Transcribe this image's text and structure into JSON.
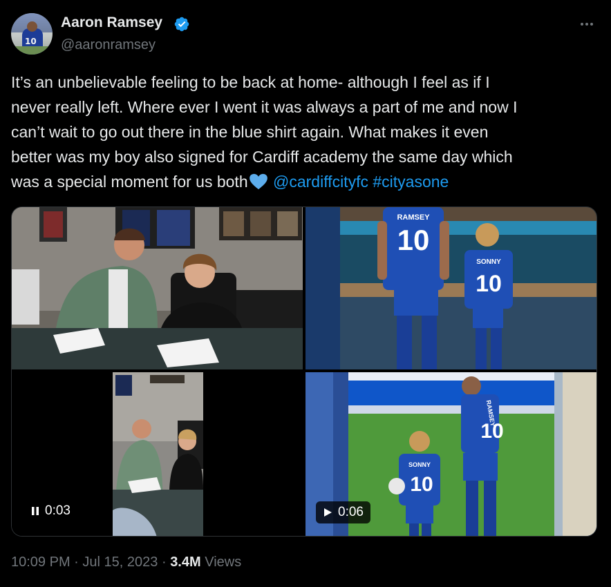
{
  "author": {
    "name": "Aaron Ramsey",
    "handle": "@aaronramsey",
    "avatar_jersey_number": "10",
    "verified": true
  },
  "tweet": {
    "line1": "It’s an unbelievable feeling to be back at home- although I feel as if I",
    "line2": "never really left. Where ever I went it was always a part of me and now I",
    "line3": "can’t wait to go out there in the blue shirt again.  What makes it even",
    "line4": "better was my boy also signed for Cardiff academy the same day which",
    "line5": "was a special moment for us both",
    "mention": "@cardiffcityfc",
    "hashtag": "#cityasone",
    "emoji": "blue-heart"
  },
  "media": [
    {
      "kind": "photo"
    },
    {
      "kind": "photo",
      "jersey_left_name": "RAMSEY",
      "jersey_left_number": "10",
      "jersey_right_name": "SONNY",
      "jersey_right_number": "10"
    },
    {
      "kind": "video",
      "duration": "0:03",
      "control": "pause"
    },
    {
      "kind": "video",
      "duration": "0:06",
      "control": "play",
      "jersey_left_name": "SONNY",
      "jersey_left_number": "10",
      "jersey_right_name": "RAMSEY",
      "jersey_right_number": "10"
    }
  ],
  "footer": {
    "time": "10:09 PM",
    "sep1": "·",
    "date": "Jul 15, 2023",
    "sep2": "·",
    "views_count": "3.4M",
    "views_label": "Views"
  },
  "colors": {
    "background": "#000000",
    "text": "#e7e9ea",
    "muted": "#71767b",
    "link": "#1d9bf0",
    "verified": "#1d9bf0",
    "border": "#2f3336"
  }
}
